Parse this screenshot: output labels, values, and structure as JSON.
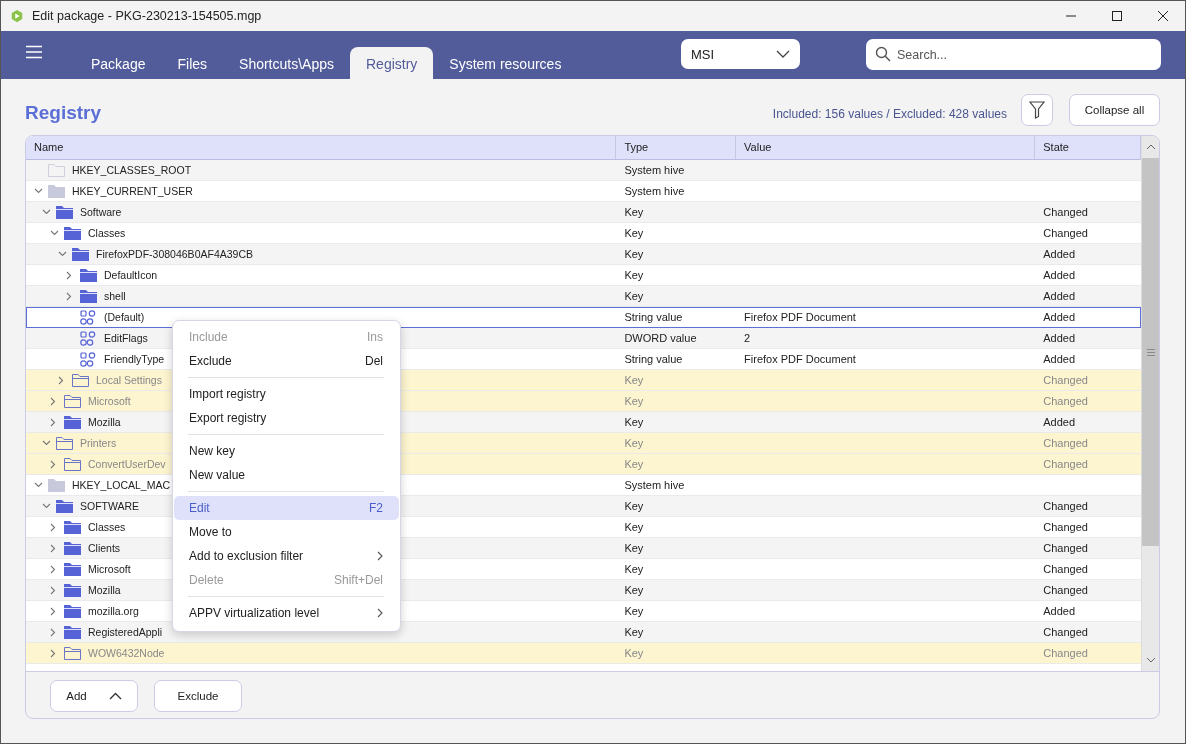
{
  "window": {
    "title": "Edit package - PKG-230213-154505.mgp"
  },
  "tabs": [
    {
      "label": "Package",
      "selected": false
    },
    {
      "label": "Files",
      "selected": false
    },
    {
      "label": "Shortcuts\\Apps",
      "selected": false
    },
    {
      "label": "Registry",
      "selected": true
    },
    {
      "label": "System resources",
      "selected": false
    }
  ],
  "format_dropdown": {
    "value": "MSI"
  },
  "search": {
    "placeholder": "Search..."
  },
  "page_title": "Registry",
  "summary": "Included: 156 values / Excluded: 428 values",
  "collapse_button": "Collapse all",
  "table": {
    "columns": [
      "Name",
      "Type",
      "Value",
      "State"
    ],
    "rows": [
      {
        "kind": "hive",
        "name": "HKEY_CLASSES_ROOT",
        "type": "System hive",
        "excluded": false,
        "selected": false
      },
      {
        "kind": "hive",
        "name": "HKEY_CURRENT_USER",
        "type": "System hive",
        "expanded": true,
        "excluded": false,
        "selected": false,
        "children": [
          {
            "kind": "key",
            "name": "Software",
            "type": "Key",
            "state": "Changed",
            "expanded": true,
            "excluded": false,
            "selected": false,
            "children": [
              {
                "kind": "key",
                "name": "Classes",
                "type": "Key",
                "state": "Changed",
                "expanded": true,
                "excluded": false,
                "selected": false,
                "children": [
                  {
                    "kind": "key",
                    "name": "FirefoxPDF-308046B0AF4A39CB",
                    "type": "Key",
                    "state": "Added",
                    "expanded": true,
                    "excluded": false,
                    "selected": false,
                    "children": [
                      {
                        "kind": "key",
                        "name": "DefaultIcon",
                        "type": "Key",
                        "state": "Added",
                        "expanded": false,
                        "excluded": false,
                        "selected": false
                      },
                      {
                        "kind": "key",
                        "name": "shell",
                        "type": "Key",
                        "state": "Added",
                        "expanded": false,
                        "excluded": false,
                        "selected": false
                      },
                      {
                        "kind": "value",
                        "name": "(Default)",
                        "type": "String value",
                        "value": "Firefox PDF Document",
                        "state": "Added",
                        "excluded": false,
                        "selected": true
                      },
                      {
                        "kind": "value",
                        "name": "EditFlags",
                        "type": "DWORD value",
                        "value": "2",
                        "state": "Added",
                        "excluded": false,
                        "selected": false
                      },
                      {
                        "kind": "value",
                        "name": "FriendlyType",
                        "type": "String value",
                        "value": "Firefox PDF Document",
                        "state": "Added",
                        "excluded": false,
                        "selected": false
                      }
                    ]
                  },
                  {
                    "kind": "key",
                    "name": "Local Settings",
                    "type": "Key",
                    "state": "Changed",
                    "expanded": false,
                    "excluded": true,
                    "selected": false
                  }
                ]
              },
              {
                "kind": "key",
                "name": "Microsoft",
                "type": "Key",
                "state": "Changed",
                "expanded": false,
                "excluded": true,
                "selected": false
              },
              {
                "kind": "key",
                "name": "Mozilla",
                "type": "Key",
                "state": "Added",
                "expanded": false,
                "excluded": false,
                "selected": false
              }
            ]
          },
          {
            "kind": "key",
            "name": "Printers",
            "type": "Key",
            "state": "Changed",
            "expanded": true,
            "excluded": true,
            "selected": false,
            "children": [
              {
                "kind": "key",
                "name": "ConvertUserDev",
                "type": "Key",
                "state": "Changed",
                "expanded": false,
                "excluded": true,
                "selected": false
              }
            ]
          }
        ]
      },
      {
        "kind": "hive",
        "name": "HKEY_LOCAL_MAC",
        "type": "System hive",
        "expanded": true,
        "excluded": false,
        "selected": false,
        "children": [
          {
            "kind": "key",
            "name": "SOFTWARE",
            "type": "Key",
            "state": "Changed",
            "expanded": true,
            "excluded": false,
            "selected": false,
            "children": [
              {
                "kind": "key",
                "name": "Classes",
                "type": "Key",
                "state": "Changed",
                "expanded": false,
                "excluded": false,
                "selected": false
              },
              {
                "kind": "key",
                "name": "Clients",
                "type": "Key",
                "state": "Changed",
                "expanded": false,
                "excluded": false,
                "selected": false
              },
              {
                "kind": "key",
                "name": "Microsoft",
                "type": "Key",
                "state": "Changed",
                "expanded": false,
                "excluded": false,
                "selected": false
              },
              {
                "kind": "key",
                "name": "Mozilla",
                "type": "Key",
                "state": "Changed",
                "expanded": false,
                "excluded": false,
                "selected": false
              },
              {
                "kind": "key",
                "name": "mozilla.org",
                "type": "Key",
                "state": "Added",
                "expanded": false,
                "excluded": false,
                "selected": false
              },
              {
                "kind": "key",
                "name": "RegisteredAppli",
                "type": "Key",
                "state": "Changed",
                "expanded": false,
                "excluded": false,
                "selected": false
              },
              {
                "kind": "key",
                "name": "WOW6432Node",
                "type": "Key",
                "state": "Changed",
                "expanded": false,
                "excluded": true,
                "selected": false
              }
            ]
          }
        ]
      }
    ]
  },
  "context_menu": [
    {
      "kind": "item",
      "label": "Include",
      "shortcut": "Ins",
      "disabled": true,
      "highlighted": false
    },
    {
      "kind": "item",
      "label": "Exclude",
      "shortcut": "Del",
      "disabled": false,
      "highlighted": false
    },
    {
      "kind": "separator"
    },
    {
      "kind": "item",
      "label": "Import registry",
      "disabled": false,
      "highlighted": false
    },
    {
      "kind": "item",
      "label": "Export registry",
      "disabled": false,
      "highlighted": false
    },
    {
      "kind": "separator"
    },
    {
      "kind": "item",
      "label": "New key",
      "disabled": false,
      "highlighted": false
    },
    {
      "kind": "item",
      "label": "New value",
      "disabled": false,
      "highlighted": false
    },
    {
      "kind": "separator"
    },
    {
      "kind": "item",
      "label": "Edit",
      "shortcut": "F2",
      "disabled": false,
      "highlighted": true
    },
    {
      "kind": "item",
      "label": "Move to",
      "disabled": false,
      "highlighted": false
    },
    {
      "kind": "item",
      "label": "Add to exclusion filter",
      "submenu": true,
      "disabled": false,
      "highlighted": false
    },
    {
      "kind": "item",
      "label": "Delete",
      "shortcut": "Shift+Del",
      "disabled": true,
      "highlighted": false
    },
    {
      "kind": "separator"
    },
    {
      "kind": "item",
      "label": "APPV virtualization level",
      "submenu": true,
      "disabled": false,
      "highlighted": false
    }
  ],
  "bottom_buttons": [
    {
      "kind": "dropdown",
      "label": "Add"
    },
    {
      "kind": "plain",
      "label": "Exclude"
    }
  ]
}
